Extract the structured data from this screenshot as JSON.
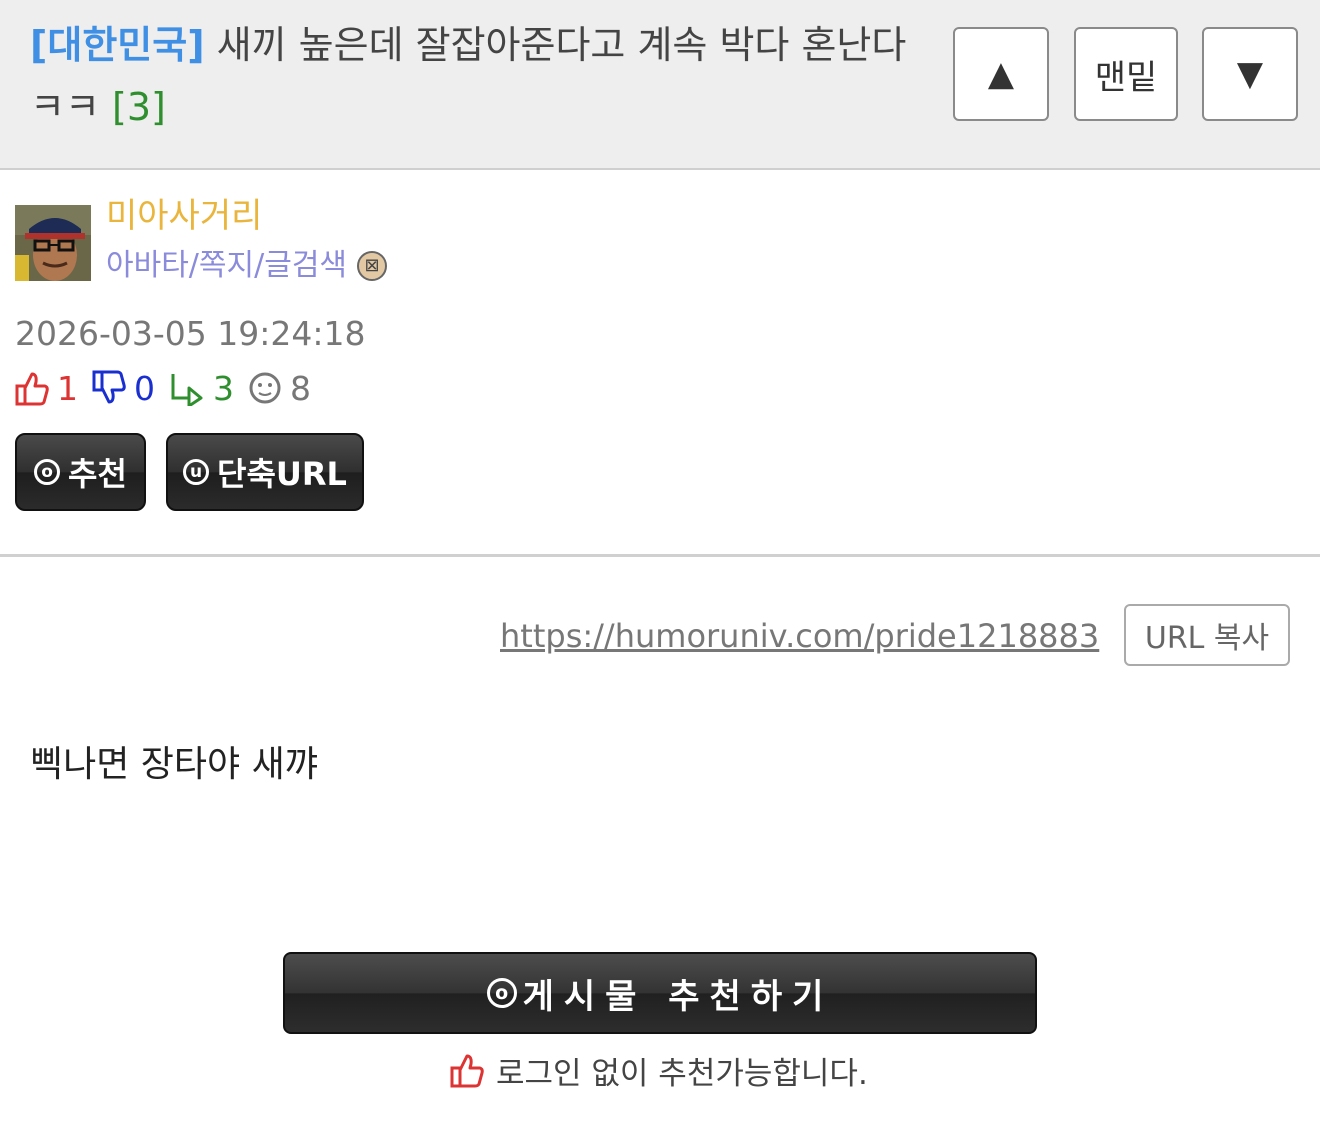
{
  "header": {
    "category": "[대한민국]",
    "title": "새끼 높은데 잘잡아준다고 계속 박다 혼난다 ㅋㅋ",
    "comment_count": "[3]",
    "nav_up_icon": "▲",
    "nav_bottom_label": "맨밑",
    "nav_down_icon": "▼"
  },
  "author": {
    "name": "미아사거리",
    "links": "아바타/쪽지/글검색",
    "level_icon": "level-badge-icon"
  },
  "post": {
    "date": "2026-03-05 19:24:18",
    "stats": {
      "up": "1",
      "down": "0",
      "comments": "3",
      "views": "8"
    },
    "recommend_button": "추천",
    "recommend_icon": "ⓞ",
    "shorturl_button": "단축URL",
    "shorturl_icon": "ⓤ",
    "url": "https://humoruniv.com/pride1218883",
    "url_copy_button": "URL 복사",
    "body": "삑나면 장타야 새꺄"
  },
  "footer": {
    "recommend_big_button": "게시물  추천하기",
    "recommend_big_icon": "ⓞ",
    "note": "로그인 없이 추천가능합니다."
  },
  "colors": {
    "category": "#3f8fe4",
    "comment_count": "#2f8f2f",
    "author_name": "#e9b53d",
    "author_links": "#8b8bdc",
    "up": "#dd3333",
    "down": "#1a2fd0"
  }
}
